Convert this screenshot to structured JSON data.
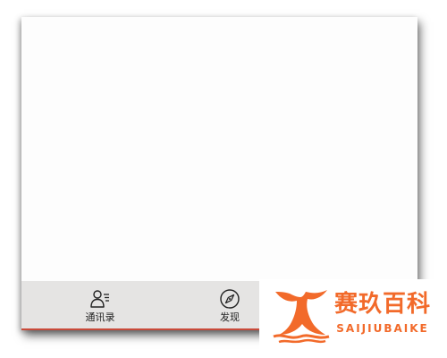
{
  "tabbar": {
    "tabs": [
      {
        "label": "通讯录",
        "icon": "contacts-icon"
      },
      {
        "label": "发现",
        "icon": "compass-icon"
      }
    ]
  },
  "watermark": {
    "name": "赛玖百科",
    "subtitle": "SAIJIUBAIKE",
    "color": "#f26a2a"
  },
  "colors": {
    "tabbar_bg": "#e5e4e3",
    "tabbar_border": "#c94a3a",
    "screen_bg": "#fdfdfd"
  }
}
